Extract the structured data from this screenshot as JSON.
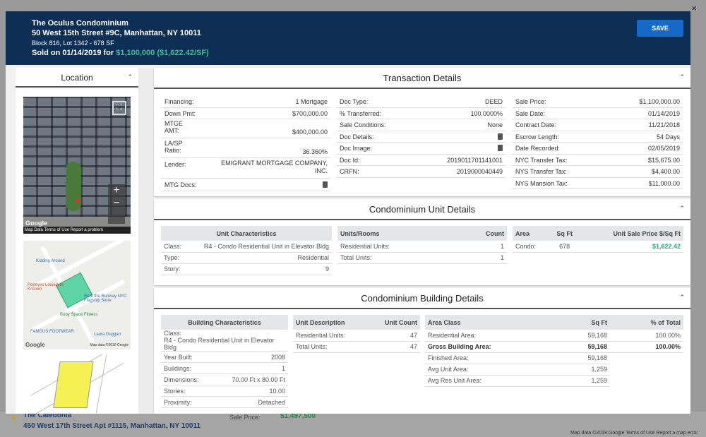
{
  "header": {
    "name": "The Oculus Condominium",
    "address": "50 West 15th Street #9C, Manhattan, NY 10011",
    "block": "Block 816, Lot 1342 - 678 SF",
    "sold_prefix": "Sold on 01/14/2019 for ",
    "sold_price": "$1,100,000 ($1,622.42/SF)",
    "save_label": "SAVE"
  },
  "location": {
    "title": "Location",
    "sv_labels": "Map Data   Terms of Use   Report a problem",
    "google": "Google",
    "map_footer": "Map data ©2019 Google",
    "pois": [
      "Kidding Around",
      "Popeyes Louisiana Kitchen",
      "Rent the Runway NYC Flagship Store",
      "Body Space Fitness",
      "FAMOUS FOOTWEAR",
      "Laura Duggan"
    ]
  },
  "transaction": {
    "title": "Transaction Details",
    "col1": [
      [
        "Financing:",
        "1 Mortgage"
      ],
      [
        "Down Pmt:",
        "$700,000.00"
      ],
      [
        "MTGE AMT:",
        "$400,000.00"
      ],
      [
        "LA/SP Ratio:",
        "36.360%"
      ],
      [
        "Lender:",
        "EMIGRANT MORTGAGE COMPANY, INC."
      ],
      [
        "MTG Docs:",
        ""
      ]
    ],
    "col2": [
      [
        "Doc Type:",
        "DEED"
      ],
      [
        "% Transferred:",
        "100.0000%"
      ],
      [
        "Sale Conditions:",
        "None"
      ],
      [
        "Doc Details:",
        ""
      ],
      [
        "Doc Image:",
        ""
      ],
      [
        "Doc Id:",
        "2019011701141001"
      ],
      [
        "CRFN:",
        "2019000040449"
      ]
    ],
    "col3": [
      [
        "Sale Price:",
        "$1,100,000.00"
      ],
      [
        "Sale Date:",
        "01/14/2019"
      ],
      [
        "Contract Date:",
        "11/21/2018"
      ],
      [
        "Escrow Length:",
        "54 Days"
      ],
      [
        "Date Recorded:",
        "02/05/2019"
      ],
      [
        "NYC Transfer Tax:",
        "$15,675.00"
      ],
      [
        "NYS Transfer Tax:",
        "$4,400.00"
      ],
      [
        "NYS Mansion Tax:",
        "$11,000.00"
      ]
    ]
  },
  "unit": {
    "title": "Condominium Unit Details",
    "char_header": "Unit Characteristics",
    "chars": [
      [
        "Class:",
        "R4 - Condo Residential Unit in Elevator Bldg"
      ],
      [
        "Type:",
        "Residential"
      ],
      [
        "Story:",
        "9"
      ]
    ],
    "rooms_headers": [
      "Units/Rooms",
      "Count"
    ],
    "rooms": [
      [
        "Residential Units:",
        "1"
      ],
      [
        "Total Units:",
        "1"
      ]
    ],
    "area_headers": [
      "Area",
      "Sq Ft",
      "Unit Sale Price $/Sq Ft"
    ],
    "area": [
      [
        "Condo:",
        "678",
        "$1,622.42"
      ]
    ]
  },
  "building": {
    "title": "Condominium Building Details",
    "char_header": "Building Characteristics",
    "chars": [
      [
        "Class:",
        "R4 - Condo Residential Unit in Elevator Bldg"
      ],
      [
        "Year Built:",
        "2008"
      ],
      [
        "Buildings:",
        "1"
      ],
      [
        "Dimensions:",
        "70.00 Ft x 80.00 Ft"
      ],
      [
        "Stories:",
        "10.00"
      ],
      [
        "Proximity:",
        "Detached"
      ]
    ],
    "units_headers": [
      "Unit Description",
      "Unit Count"
    ],
    "units": [
      [
        "Residential Units:",
        "47"
      ],
      [
        "Total Units:",
        "47"
      ]
    ],
    "area_headers": [
      "Area Class",
      "Sq Ft",
      "% of Total"
    ],
    "area": [
      [
        "Residential Area:",
        "59,168",
        "100.00%"
      ],
      [
        "Gross Building Area:",
        "59,168",
        "100.00%"
      ],
      [
        "Finished Area:",
        "59,168",
        ""
      ],
      [
        "Avg Unit Area:",
        "1,259",
        ""
      ],
      [
        "Avg Res Unit Area:",
        "1,259",
        ""
      ]
    ]
  },
  "background": {
    "name": "The Caledonia",
    "address": "450 West 17th Street Apt #1115, Manhattan, NY 10011",
    "sale_label": "Sale Price:",
    "sale_value": "$1,497,500",
    "map_footer": "Map data ©2019 Google   Terms of Use   Report a map error"
  },
  "colors": {
    "header_bg": "#0e2f55",
    "accent_green": "#3fbf8f",
    "save_button": "#1769c7"
  }
}
